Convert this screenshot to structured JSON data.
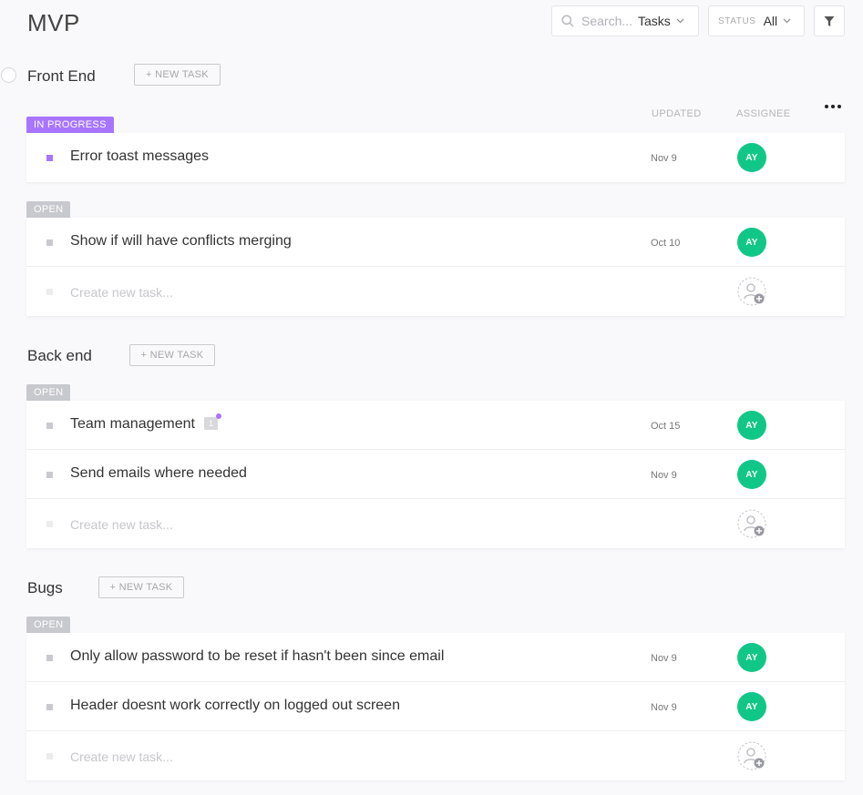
{
  "page": {
    "title": "MVP"
  },
  "toolbar": {
    "search_placeholder": "Search...",
    "search_scope": "Tasks",
    "status_label": "STATUS",
    "status_value": "All"
  },
  "columns": {
    "updated": "UPDATED",
    "assignee": "ASSIGNEE"
  },
  "new_task_label": "+ NEW TASK",
  "create_placeholder": "Create new task...",
  "lists": [
    {
      "name": "Front End",
      "groups": [
        {
          "status": "IN PROGRESS",
          "color": "#a875ff",
          "tasks": [
            {
              "name": "Error toast messages",
              "updated": "Nov 9",
              "assignee": "AY"
            }
          ]
        },
        {
          "status": "OPEN",
          "color": "#c8c8cf",
          "tasks": [
            {
              "name": "Show if will have conflicts merging",
              "updated": "Oct 10",
              "assignee": "AY"
            }
          ]
        }
      ]
    },
    {
      "name": "Back end",
      "groups": [
        {
          "status": "OPEN",
          "color": "#c8c8cf",
          "tasks": [
            {
              "name": "Team management",
              "updated": "Oct 15",
              "assignee": "AY",
              "comments": "1"
            },
            {
              "name": "Send emails where needed",
              "updated": "Nov 9",
              "assignee": "AY"
            }
          ]
        }
      ]
    },
    {
      "name": "Bugs",
      "groups": [
        {
          "status": "OPEN",
          "color": "#c8c8cf",
          "tasks": [
            {
              "name": "Only allow password to be reset if hasn't been since email",
              "updated": "Nov 9",
              "assignee": "AY"
            },
            {
              "name": "Header doesnt work correctly on logged out screen",
              "updated": "Nov 9",
              "assignee": "AY"
            }
          ]
        }
      ]
    }
  ],
  "colors": {
    "accent": "#a875ff",
    "avatar": "#11c787",
    "open_tag": "#c8c8cf"
  }
}
